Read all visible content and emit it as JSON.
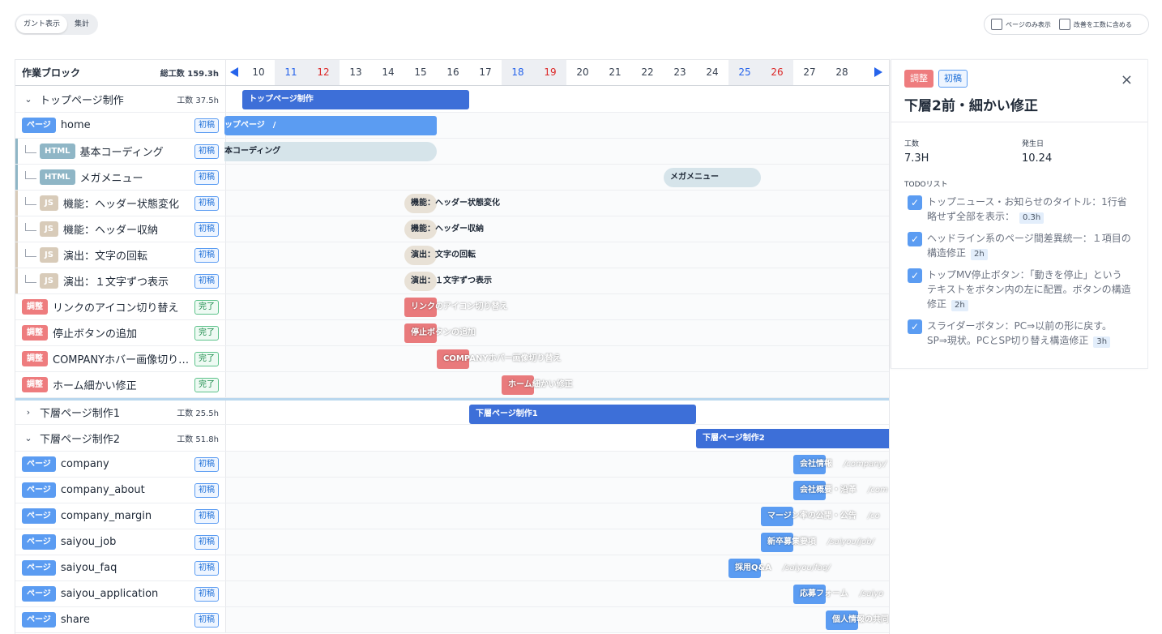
{
  "view_toggle": {
    "gantt": "ガント表示",
    "summary": "集計"
  },
  "options": {
    "pages_only": "ページのみ表示",
    "include_revisions": "改善を工数に含める"
  },
  "header": {
    "title": "作業ブロック",
    "total": "総工数 159.3h",
    "days": [
      "10",
      "11",
      "12",
      "13",
      "14",
      "15",
      "16",
      "17",
      "18",
      "19",
      "20",
      "21",
      "22",
      "23",
      "24",
      "25",
      "26",
      "27",
      "28"
    ]
  },
  "groups": {
    "top": {
      "name": "トップページ制作",
      "hours": "工数 37.5h",
      "bar": "トップページ制作"
    },
    "sub1": {
      "name": "下層ページ制作1",
      "hours": "工数 25.5h",
      "bar": "下層ページ制作1"
    },
    "sub2": {
      "name": "下層ページ制作2",
      "hours": "工数 51.8h",
      "bar": "下層ページ制作2"
    }
  },
  "tags": {
    "page": "ページ",
    "html": "HTML",
    "js": "JS",
    "adj": "調整"
  },
  "status": {
    "draft": "初稿",
    "done": "完了"
  },
  "items": [
    {
      "name": "home",
      "bar": "ップページ　/"
    },
    {
      "name": "基本コーディング",
      "bar": "本コーディング"
    },
    {
      "name": "メガメニュー",
      "bar": "メガメニュー"
    },
    {
      "name": "機能：ヘッダー状態変化",
      "bar": "機能：ヘッダー状態変化"
    },
    {
      "name": "機能：ヘッダー収納",
      "bar": "機能：ヘッダー収納"
    },
    {
      "name": "演出：文字の回転",
      "bar": "演出：文字の回転"
    },
    {
      "name": "演出：１文字ずつ表示",
      "bar": "演出：１文字ずつ表示"
    },
    {
      "name": "リンクのアイコン切り替え",
      "bar": "リンクのアイコン切り替え"
    },
    {
      "name": "停止ボタンの追加",
      "bar": "停止ボタンの追加"
    },
    {
      "name": "COMPANYホバー画像切り…",
      "bar": "COMPANYホバー画像切り替え"
    },
    {
      "name": "ホーム細かい修正",
      "bar": "ホーム細かい修正"
    },
    {
      "name": "company",
      "bar": "会社情報",
      "path": "/company/"
    },
    {
      "name": "company_about",
      "bar": "会社概要・沿革",
      "path": "/com"
    },
    {
      "name": "company_margin",
      "bar": "マージン率の公開・公告",
      "path": "/co"
    },
    {
      "name": "saiyou_job",
      "bar": "新卒募集要項",
      "path": "/saiyou/job/"
    },
    {
      "name": "saiyou_faq",
      "bar": "採用Q&A",
      "path": "/saiyou/faq/"
    },
    {
      "name": "saiyou_application",
      "bar": "応募フォーム",
      "path": "/saiyo"
    },
    {
      "name": "share",
      "bar": "個人情報の共同"
    }
  ],
  "detail": {
    "tag_adj": "調整",
    "tag_draft": "初稿",
    "close": "×",
    "title": "下層2前・細かい修正",
    "hours_label": "工数",
    "hours_value": "7.3H",
    "date_label": "発生日",
    "date_value": "10.24",
    "todo_title": "TODOリスト",
    "todos": [
      {
        "text": "トップニュース・お知らせのタイトル：1行省略せず全部を表示：",
        "hours": "0.3h"
      },
      {
        "text": "ヘッドライン系のページ間差異統一：１項目の構造修正",
        "hours": "2h"
      },
      {
        "text": "トップMV停止ボタン：「動きを停止」というテキストをボタン内の左に配置。ボタンの構造修正",
        "hours": "2h"
      },
      {
        "text": "スライダーボタン：PC⇒以前の形に戻す。SP⇒現状。PCとSP切り替え構造修正",
        "hours": "3h"
      }
    ]
  },
  "colors": {
    "accent": "#2563eb",
    "group_bar": "#3d6fd8",
    "page": "#5b9cf2",
    "adjust": "#ee7c7e",
    "html": "#8fb6c6",
    "js": "#d8cbb9"
  }
}
